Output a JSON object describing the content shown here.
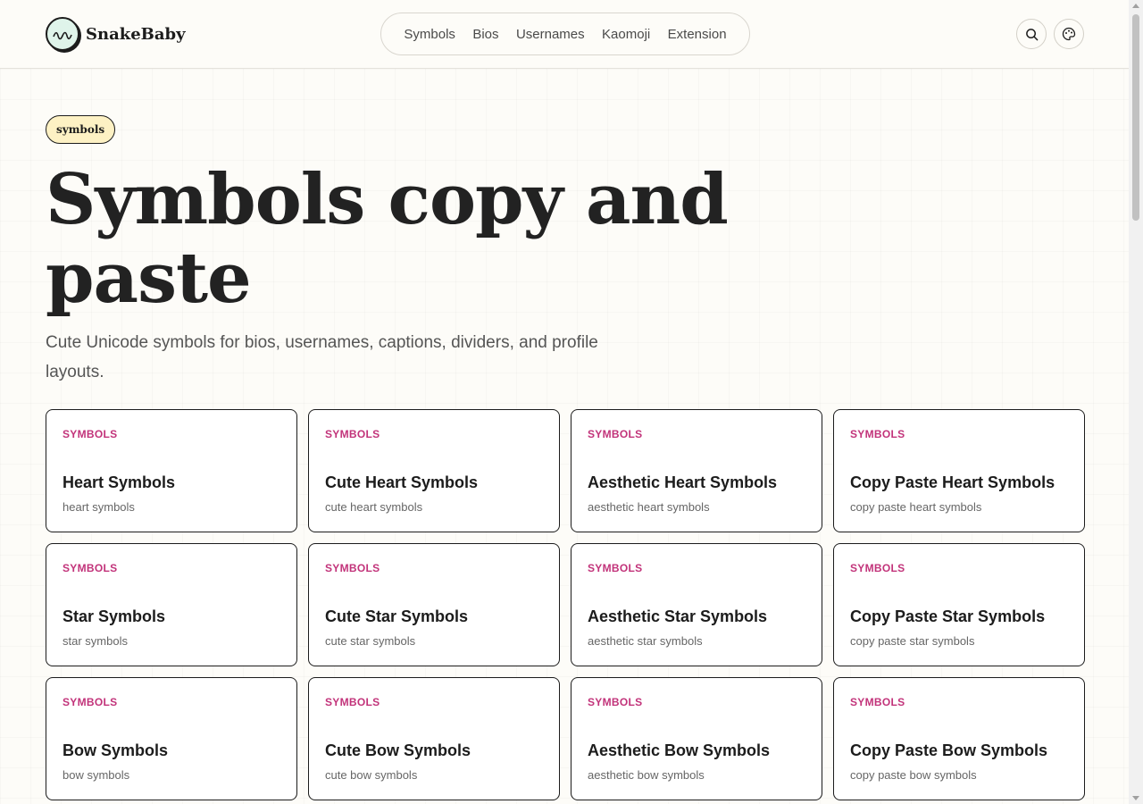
{
  "brand": {
    "name": "SnakeBaby",
    "accent": "#dff4ea"
  },
  "nav": {
    "links": [
      "Symbols",
      "Bios",
      "Usernames",
      "Kaomoji",
      "Extension"
    ]
  },
  "hero": {
    "badge": "symbols",
    "title": "Symbols copy and paste",
    "subtitle": "Cute Unicode symbols for bios, usernames, captions, dividers, and profile layouts."
  },
  "colors": {
    "tag": "#c2337a",
    "badge_bg": "#fdf1c4",
    "page_bg": "#fdfcf8"
  },
  "cards": [
    {
      "tag": "SYMBOLS",
      "title": "Heart Symbols",
      "sub": "heart symbols"
    },
    {
      "tag": "SYMBOLS",
      "title": "Cute Heart Symbols",
      "sub": "cute heart symbols"
    },
    {
      "tag": "SYMBOLS",
      "title": "Aesthetic Heart Symbols",
      "sub": "aesthetic heart symbols"
    },
    {
      "tag": "SYMBOLS",
      "title": "Copy Paste Heart Symbols",
      "sub": "copy paste heart symbols"
    },
    {
      "tag": "SYMBOLS",
      "title": "Star Symbols",
      "sub": "star symbols"
    },
    {
      "tag": "SYMBOLS",
      "title": "Cute Star Symbols",
      "sub": "cute star symbols"
    },
    {
      "tag": "SYMBOLS",
      "title": "Aesthetic Star Symbols",
      "sub": "aesthetic star symbols"
    },
    {
      "tag": "SYMBOLS",
      "title": "Copy Paste Star Symbols",
      "sub": "copy paste star symbols"
    },
    {
      "tag": "SYMBOLS",
      "title": "Bow Symbols",
      "sub": "bow symbols"
    },
    {
      "tag": "SYMBOLS",
      "title": "Cute Bow Symbols",
      "sub": "cute bow symbols"
    },
    {
      "tag": "SYMBOLS",
      "title": "Aesthetic Bow Symbols",
      "sub": "aesthetic bow symbols"
    },
    {
      "tag": "SYMBOLS",
      "title": "Copy Paste Bow Symbols",
      "sub": "copy paste bow symbols"
    }
  ],
  "icons": {
    "search": "search-icon",
    "theme": "palette-icon",
    "logo": "snake-logo-icon"
  }
}
